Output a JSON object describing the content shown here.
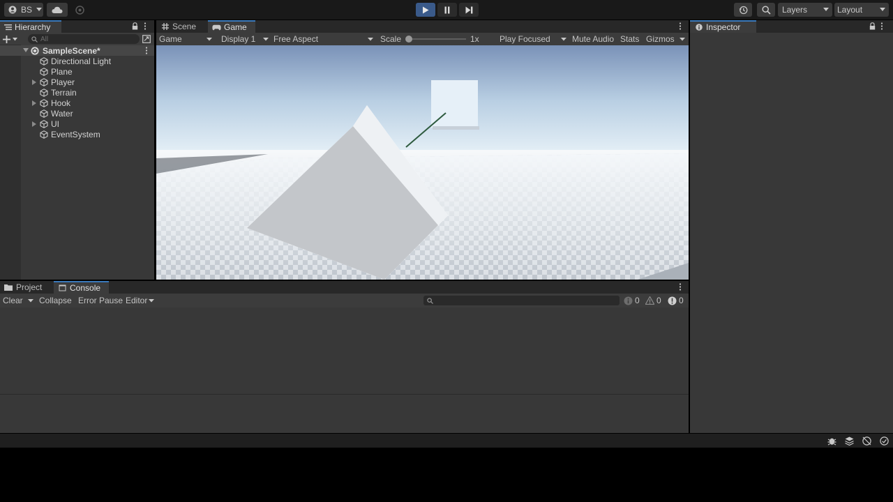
{
  "toolbar": {
    "account_label": "BS",
    "layers_label": "Layers",
    "layout_label": "Layout"
  },
  "hierarchy": {
    "tab_label": "Hierarchy",
    "search_placeholder": "All",
    "scene_name": "SampleScene*",
    "items": [
      {
        "label": "Directional Light",
        "expandable": false
      },
      {
        "label": "Plane",
        "expandable": false
      },
      {
        "label": "Player",
        "expandable": true
      },
      {
        "label": "Terrain",
        "expandable": false
      },
      {
        "label": "Hook",
        "expandable": true
      },
      {
        "label": "Water",
        "expandable": false
      },
      {
        "label": "UI",
        "expandable": true
      },
      {
        "label": "EventSystem",
        "expandable": false
      }
    ]
  },
  "game_view": {
    "tabs": [
      "Scene",
      "Game"
    ],
    "active_tab": "Game",
    "view_mode": "Game",
    "display": "Display 1",
    "aspect": "Free Aspect",
    "scale_label": "Scale",
    "scale_value": "1x",
    "play_focused": "Play Focused",
    "mute_audio": "Mute Audio",
    "stats": "Stats",
    "gizmos": "Gizmos"
  },
  "inspector": {
    "tab_label": "Inspector"
  },
  "console": {
    "tabs": [
      "Project",
      "Console"
    ],
    "active_tab": "Console",
    "clear_label": "Clear",
    "collapse_label": "Collapse",
    "error_pause_label": "Error Pause",
    "editor_label": "Editor",
    "info_count": "0",
    "warning_count": "0",
    "error_count": "0"
  },
  "colors": {
    "accent": "#3a79bb",
    "panel": "#383838",
    "toolbar": "#191919"
  }
}
